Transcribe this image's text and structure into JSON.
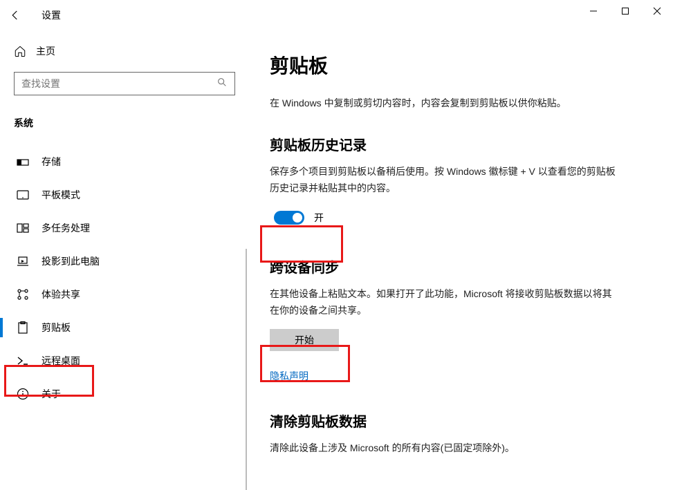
{
  "window": {
    "title": "设置"
  },
  "sidebar": {
    "home": "主页",
    "search_placeholder": "查找设置",
    "category": "系统",
    "items": [
      {
        "label": "存储"
      },
      {
        "label": "平板模式"
      },
      {
        "label": "多任务处理"
      },
      {
        "label": "投影到此电脑"
      },
      {
        "label": "体验共享"
      },
      {
        "label": "剪贴板"
      },
      {
        "label": "远程桌面"
      },
      {
        "label": "关于"
      }
    ]
  },
  "main": {
    "title": "剪贴板",
    "intro": "在 Windows 中复制或剪切内容时，内容会复制到剪贴板以供你粘贴。",
    "history": {
      "heading": "剪贴板历史记录",
      "desc": "保存多个项目到剪贴板以备稍后使用。按 Windows 徽标键 + V 以查看您的剪贴板历史记录并粘贴其中的内容。",
      "toggle_label": "开"
    },
    "sync": {
      "heading": "跨设备同步",
      "desc": "在其他设备上粘贴文本。如果打开了此功能，Microsoft 将接收剪贴板数据以将其在你的设备之间共享。",
      "button": "开始",
      "privacy_link": "隐私声明"
    },
    "clear": {
      "heading": "清除剪贴板数据",
      "desc": "清除此设备上涉及 Microsoft 的所有内容(已固定项除外)。"
    }
  }
}
